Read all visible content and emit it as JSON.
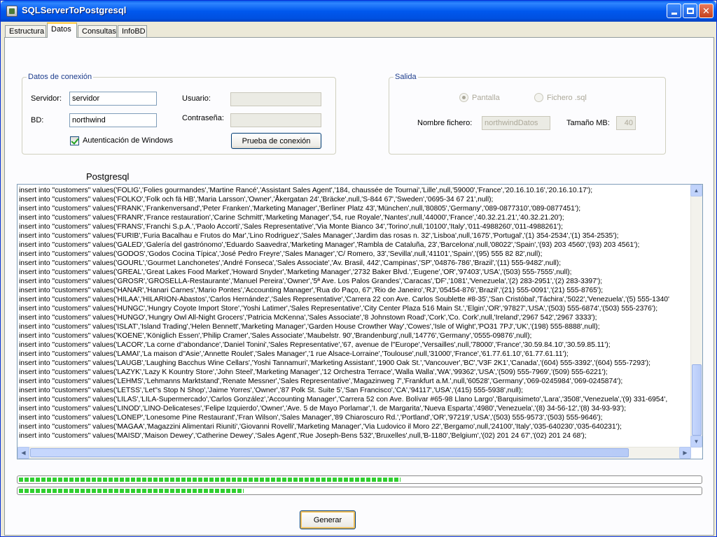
{
  "window": {
    "title": "SQLServerToPostgresql"
  },
  "tabs": [
    "Estructura",
    "Datos",
    "Consultas",
    "InfoBD"
  ],
  "connection": {
    "legend": "Datos de conexión",
    "server_label": "Servidor:",
    "server_value": "servidor",
    "db_label": "BD:",
    "db_value": "northwind",
    "user_label": "Usuario:",
    "user_value": "",
    "password_label": "Contraseña:",
    "password_value": "",
    "windows_auth_label": "Autenticación de Windows",
    "windows_auth_checked": true,
    "test_button": "Prueba de conexión"
  },
  "output": {
    "legend": "Salida",
    "screen_label": "Pantalla",
    "file_label": "Fichero .sql",
    "selected": "Pantalla",
    "filename_label": "Nombre fichero:",
    "filename_value": "northwindDatos",
    "size_label": "Tamaño MB:",
    "size_value": "40"
  },
  "console_title": "Postgresql",
  "console_lines": [
    "insert into \"customers\" values('FOLIG','Folies gourmandes','Martine Rancé','Assistant Sales Agent','184, chaussée de Tournai','Lille',null,'59000','France','20.16.10.16','20.16.10.17');",
    "insert into \"customers\" values('FOLKO','Folk och fä HB','Maria Larsson','Owner','Åkergatan 24','Bräcke',null,'S-844 67','Sweden','0695-34 67 21',null);",
    "insert into \"customers\" values('FRANK','Frankenversand','Peter Franken','Marketing Manager','Berliner Platz 43','München',null,'80805','Germany','089-0877310','089-0877451');",
    "insert into \"customers\" values('FRANR','France restauration','Carine Schmitt','Marketing Manager','54, rue Royale','Nantes',null,'44000','France','40.32.21.21','40.32.21.20');",
    "insert into \"customers\" values('FRANS','Franchi S.p.A.','Paolo Accorti','Sales Representative','Via Monte Bianco 34','Torino',null,'10100','Italy','011-4988260','011-4988261');",
    "insert into \"customers\" values('FURIB','Furia Bacalhau e Frutos do Mar','Lino Rodriguez','Sales Manager','Jardim das rosas n. 32','Lisboa',null,'1675','Portugal','(1) 354-2534','(1) 354-2535');",
    "insert into \"customers\" values('GALED','Galería del gastrónomo','Eduardo Saavedra','Marketing Manager','Rambla de Cataluña, 23','Barcelona',null,'08022','Spain','(93) 203 4560','(93) 203 4561');",
    "insert into \"customers\" values('GODOS','Godos Cocina Típica','José Pedro Freyre','Sales Manager','C/ Romero, 33','Sevilla',null,'41101','Spain','(95) 555 82 82',null);",
    "insert into \"customers\" values('GOURL','Gourmet Lanchonetes','André Fonseca','Sales Associate','Av. Brasil, 442','Campinas','SP','04876-786','Brazil','(11) 555-9482',null);",
    "insert into \"customers\" values('GREAL','Great Lakes Food Market','Howard Snyder','Marketing Manager','2732 Baker Blvd.','Eugene','OR','97403','USA','(503) 555-7555',null);",
    "insert into \"customers\" values('GROSR','GROSELLA-Restaurante','Manuel Pereira','Owner','5ª Ave. Los Palos Grandes','Caracas','DF','1081','Venezuela','(2) 283-2951','(2) 283-3397');",
    "insert into \"customers\" values('HANAR','Hanari Carnes','Mario Pontes','Accounting Manager','Rua do Paço, 67','Rio de Janeiro','RJ','05454-876','Brazil','(21) 555-0091','(21) 555-8765');",
    "insert into \"customers\" values('HILAA','HILARION-Abastos','Carlos Hernández','Sales Representative','Carrera 22 con Ave. Carlos Soublette #8-35','San Cristóbal','Táchira','5022','Venezuela','(5) 555-1340'",
    "insert into \"customers\" values('HUNGC','Hungry Coyote Import Store','Yoshi Latimer','Sales Representative','City Center Plaza 516 Main St.','Elgin','OR','97827','USA','(503) 555-6874','(503) 555-2376');",
    "insert into \"customers\" values('HUNGO','Hungry Owl All-Night Grocers','Patricia McKenna','Sales Associate','8 Johnstown Road','Cork','Co. Cork',null,'Ireland','2967 542','2967 3333');",
    "insert into \"customers\" values('ISLAT','Island Trading','Helen Bennett','Marketing Manager','Garden House Crowther Way','Cowes','Isle of Wight','PO31 7PJ','UK','(198) 555-8888',null);",
    "insert into \"customers\" values('KOENE','Königlich Essen','Philip Cramer','Sales Associate','Maubelstr. 90','Brandenburg',null,'14776','Germany','0555-09876',null);",
    "insert into \"customers\" values('LACOR','La corne d''abondance','Daniel Tonini','Sales Representative','67, avenue de l''Europe','Versailles',null,'78000','France','30.59.84.10','30.59.85.11');",
    "insert into \"customers\" values('LAMAI','La maison d''Asie','Annette Roulet','Sales Manager','1 rue Alsace-Lorraine','Toulouse',null,'31000','France','61.77.61.10','61.77.61.11');",
    "insert into \"customers\" values('LAUGB','Laughing Bacchus Wine Cellars','Yoshi Tannamuri','Marketing Assistant','1900 Oak St.','Vancouver','BC','V3F 2K1','Canada','(604) 555-3392','(604) 555-7293');",
    "insert into \"customers\" values('LAZYK','Lazy K Kountry Store','John Steel','Marketing Manager','12 Orchestra Terrace','Walla Walla','WA','99362','USA','(509) 555-7969','(509) 555-6221');",
    "insert into \"customers\" values('LEHMS','Lehmanns Marktstand','Renate Messner','Sales Representative','Magazinweg 7','Frankfurt a.M.',null,'60528','Germany','069-0245984','069-0245874');",
    "insert into \"customers\" values('LETSS','Let''s Stop N Shop','Jaime Yorres','Owner','87 Polk St. Suite 5','San Francisco','CA','94117','USA','(415) 555-5938',null);",
    "insert into \"customers\" values('LILAS','LILA-Supermercado','Carlos González','Accounting Manager','Carrera 52 con Ave. Bolívar #65-98 Llano Largo','Barquisimeto','Lara','3508','Venezuela','(9) 331-6954',",
    "insert into \"customers\" values('LINOD','LINO-Delicateses','Felipe Izquierdo','Owner','Ave. 5 de Mayo Porlamar','I. de Margarita','Nueva Esparta','4980','Venezuela','(8) 34-56-12','(8) 34-93-93');",
    "insert into \"customers\" values('LONEP','Lonesome Pine Restaurant','Fran Wilson','Sales Manager','89 Chiaroscuro Rd.','Portland','OR','97219','USA','(503) 555-9573','(503) 555-9646');",
    "insert into \"customers\" values('MAGAA','Magazzini Alimentari Riuniti','Giovanni Rovelli','Marketing Manager','Via Ludovico il Moro 22','Bergamo',null,'24100','Italy','035-640230','035-640231');",
    "insert into \"customers\" values('MAISD','Maison Dewey','Catherine Dewey','Sales Agent','Rue Joseph-Bens 532','Bruxelles',null,'B-1180','Belgium','(02) 201 24 67','(02) 201 24 68');"
  ],
  "progress": {
    "bar1_fraction": 0.56,
    "bar2_fraction": 0.33
  },
  "generate_button": "Generar",
  "icons": {
    "minimize": "minimize-icon",
    "maximize": "maximize-icon",
    "close": "close-icon"
  }
}
